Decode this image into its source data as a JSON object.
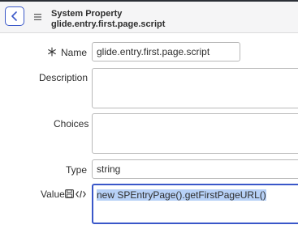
{
  "header": {
    "record_type": "System Property",
    "record_name": "glide.entry.first.page.script"
  },
  "form": {
    "name_label": "Name",
    "name_value": "glide.entry.first.page.script",
    "description_label": "Description",
    "description_value": "",
    "choices_label": "Choices",
    "choices_value": "",
    "type_label": "Type",
    "type_value": "string",
    "value_label": "Value",
    "value_value": "new SPEntryPage().getFirstPageURL()"
  },
  "icons": {
    "back": "chevron-left-icon",
    "menu": "hamburger-menu-icon",
    "required": "asterisk-icon",
    "save": "floppy-disk-icon",
    "code": "code-brackets-icon"
  },
  "colors": {
    "accent": "#3a57c9",
    "selection": "#b7d1f7"
  }
}
